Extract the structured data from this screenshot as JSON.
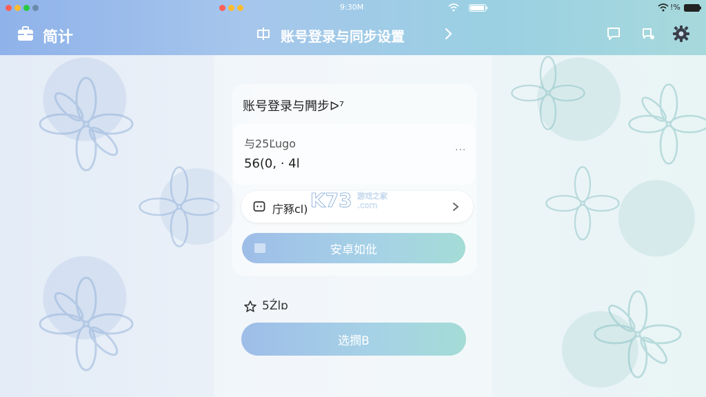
{
  "statusbar": {
    "time": "9:30M",
    "battery_text": "!%"
  },
  "app": {
    "brand": "简计"
  },
  "header": {
    "title": "账号登录与同步设置"
  },
  "card": {
    "title": "账号登录与闁步ᐅ⁷",
    "sub_label": "与25Ľugo",
    "value": "56(0, · 4l",
    "select_label": "庁豩cl)",
    "primary_button": "安卓如仳",
    "star_label": "5Źlɒ",
    "secondary_button": "选撋B"
  },
  "watermark": {
    "brand": "K73",
    "sub": "游戏之家",
    "domain": ".com"
  },
  "colors": {
    "accent_start": "#8fb2ea",
    "accent_end": "#a4dcd6"
  }
}
